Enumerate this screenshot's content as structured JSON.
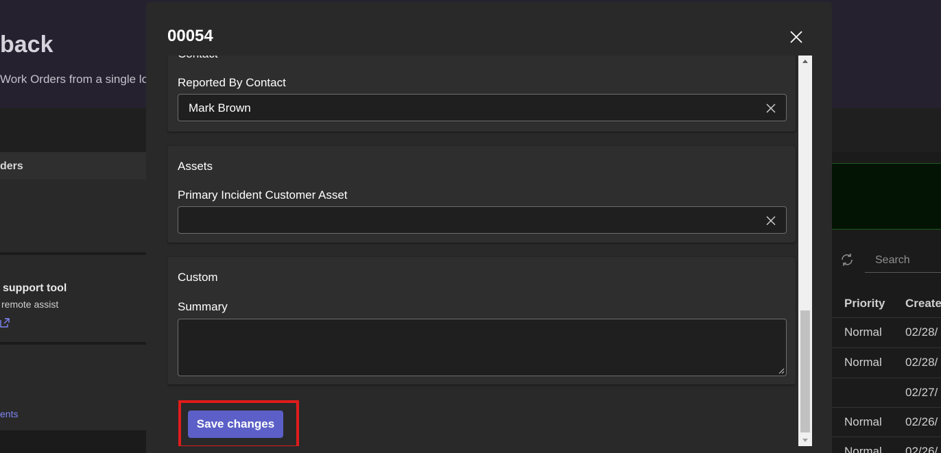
{
  "background": {
    "title": "back",
    "subtitle": "Work Orders from a single lo",
    "orders_label": "ders",
    "tool_title": "support tool",
    "tool_subtitle": "remote assist",
    "docs_link": "ents",
    "search_placeholder": "Search",
    "table": {
      "headers": [
        "Priority",
        "Create"
      ],
      "rows": [
        [
          "Normal",
          "02/28/"
        ],
        [
          "Normal",
          "02/28/"
        ],
        [
          "",
          "02/27/"
        ],
        [
          "Normal",
          "02/26/"
        ],
        [
          "Normal",
          "02/26/"
        ]
      ]
    }
  },
  "dialog": {
    "title": "00054",
    "contact": {
      "heading": "Contact",
      "reported_by_label": "Reported By Contact",
      "reported_by_value": "Mark Brown"
    },
    "assets": {
      "heading": "Assets",
      "primary_asset_label": "Primary Incident Customer Asset",
      "primary_asset_value": ""
    },
    "custom": {
      "heading": "Custom",
      "summary_label": "Summary",
      "summary_value": ""
    },
    "save_label": "Save changes"
  },
  "colors": {
    "accent": "#5b5fc7",
    "highlight": "#e01c1c",
    "dialog_bg": "#292929",
    "section_bg": "#2e2e2e"
  },
  "icons": {
    "close": "close-icon",
    "clear": "clear-icon",
    "refresh": "refresh-icon",
    "external": "external-link-icon"
  }
}
